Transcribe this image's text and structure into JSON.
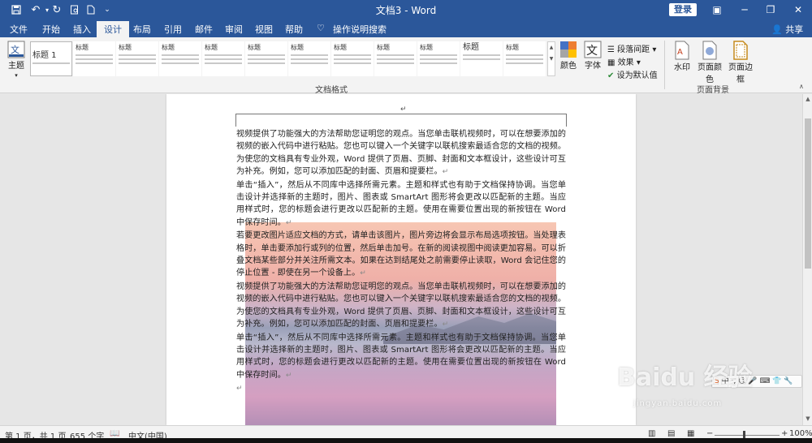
{
  "window": {
    "title": "文档3  -  Word",
    "login_label": "登录",
    "share_label": "共享"
  },
  "tabs": [
    {
      "label": "文件"
    },
    {
      "label": "开始"
    },
    {
      "label": "插入"
    },
    {
      "label": "设计"
    },
    {
      "label": "布局"
    },
    {
      "label": "引用"
    },
    {
      "label": "邮件"
    },
    {
      "label": "审阅"
    },
    {
      "label": "视图"
    },
    {
      "label": "帮助"
    },
    {
      "label": "操作说明搜索"
    }
  ],
  "ribbon": {
    "theme_label": "主题",
    "styles": [
      {
        "heading": "标题 1"
      },
      {
        "heading": "标题"
      },
      {
        "heading": "标题"
      },
      {
        "heading": "标题"
      },
      {
        "heading": "标题"
      },
      {
        "heading": "标题"
      },
      {
        "heading": "标题"
      },
      {
        "heading": "标题"
      },
      {
        "heading": "标题"
      },
      {
        "heading": "标题"
      },
      {
        "heading": "标题"
      },
      {
        "heading": "标题"
      }
    ],
    "group_doc_format": "文档格式",
    "colors_label": "颜色",
    "fonts_label": "字体",
    "paragraph_spacing_label": "段落间距",
    "effects_label": "效果",
    "set_default_label": "设为默认值",
    "watermark_label": "水印",
    "page_color_label": "页面颜色",
    "page_border_label": "页面边框",
    "group_page_background": "页面背景"
  },
  "document": {
    "paragraphs": [
      "视频提供了功能强大的方法帮助您证明您的观点。当您单击联机视频时，可以在想要添加的视频的嵌入代码中进行粘贴。您也可以键入一个关键字以联机搜索最适合您的文档的视频。为使您的文档具有专业外观，Word 提供了页眉、页脚、封面和文本框设计，这些设计可互为补充。例如，您可以添加匹配的封面、页眉和提要栏。",
      "单击“插入”，然后从不同库中选择所需元素。主题和样式也有助于文档保持协调。当您单击设计并选择新的主题时，图片、图表或 SmartArt 图形将会更改以匹配新的主题。当应用样式时，您的标题会进行更改以匹配新的主题。使用在需要位置出现的新按钮在 Word 中保存时间。",
      "若要更改图片适应文档的方式，请单击该图片，图片旁边将会显示布局选项按钮。当处理表格时，单击要添加行或列的位置，然后单击加号。在新的阅读视图中阅读更加容易。可以折叠文档某些部分并关注所需文本。如果在达到结尾处之前需要停止读取，Word 会记住您的停止位置 - 即使在另一个设备上。",
      "视频提供了功能强大的方法帮助您证明您的观点。当您单击联机视频时，可以在想要添加的视频的嵌入代码中进行粘贴。您也可以键入一个关键字以联机搜索最适合您的文档的视频。为使您的文档具有专业外观，Word 提供了页眉、页脚、封面和文本框设计，这些设计可互为补充。例如，您可以添加匹配的封面、页眉和提要栏。",
      "单击“插入”，然后从不同库中选择所需元素。主题和样式也有助于文档保持协调。当您单击设计并选择新的主题时，图片、图表或 SmartArt 图形将会更改以匹配新的主题。当应用样式时，您的标题会进行更改以匹配新的主题。使用在需要位置出现的新按钮在 Word 中保存时间。"
    ]
  },
  "status": {
    "page": "第 1 页，共 1 页",
    "words": "655 个字",
    "language": "中文(中国)",
    "zoom": "100%"
  },
  "watermark": {
    "brand": "Baidu 经验",
    "url": "jingyan.baidu.com"
  }
}
